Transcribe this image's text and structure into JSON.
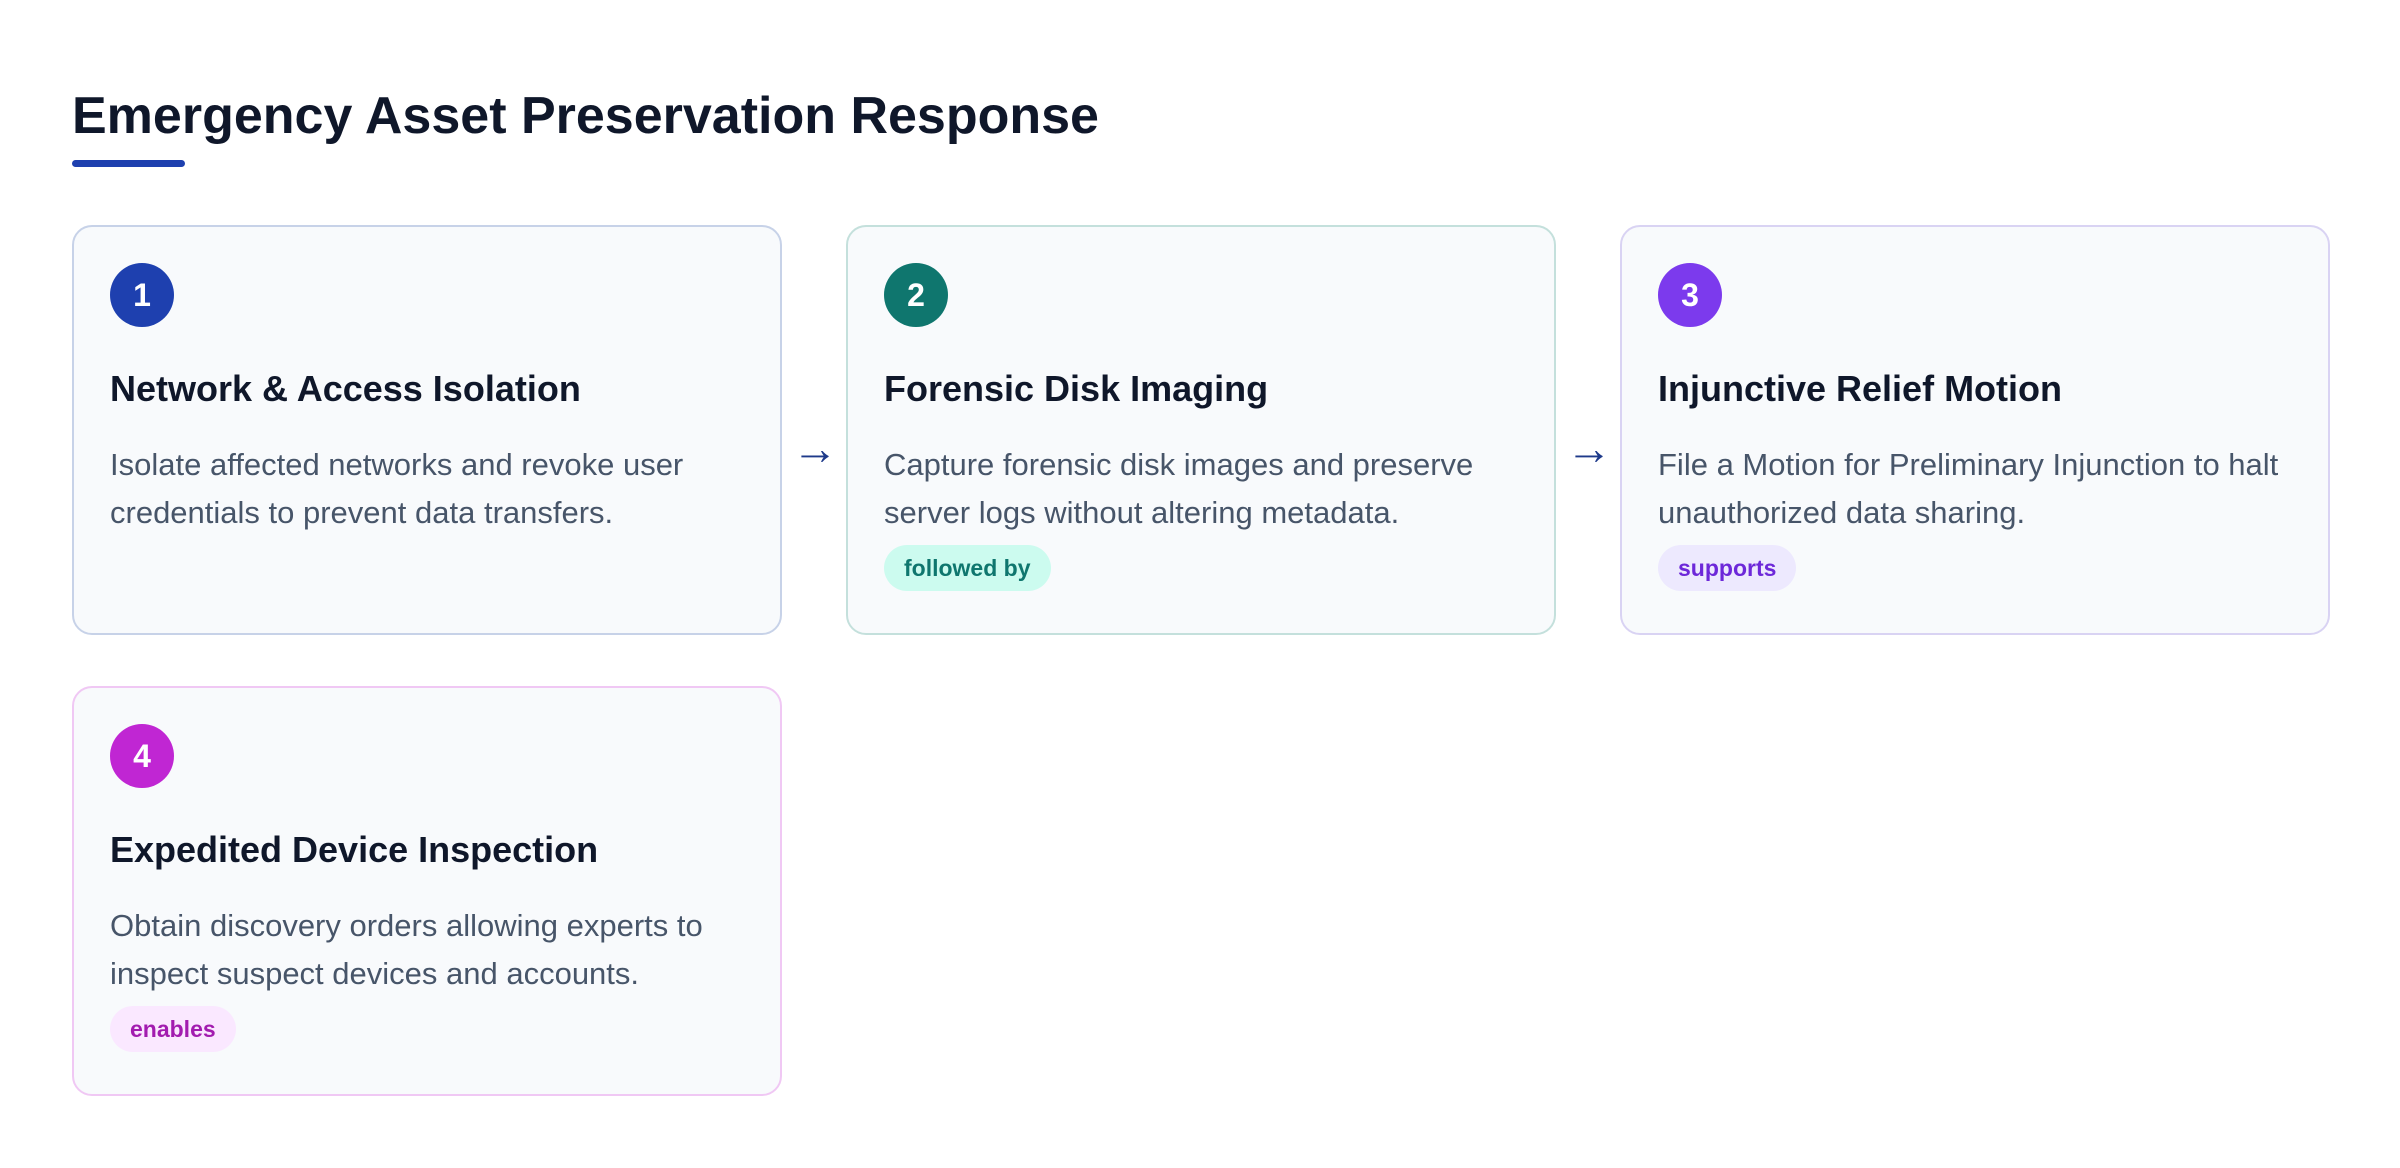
{
  "title": "Emergency Asset Preservation Response",
  "colors": {
    "accent": "#1e40af",
    "step1": "#1e40af",
    "step2": "#0f766e",
    "step3": "#7c3aed",
    "step4": "#c026d3"
  },
  "arrow_glyph": "→",
  "steps": [
    {
      "number": "1",
      "title": "Network & Access Isolation",
      "description": "Isolate affected networks and revoke user credentials to prevent data transfers."
    },
    {
      "number": "2",
      "title": "Forensic Disk Imaging",
      "description": "Capture forensic disk images and preserve server logs without altering metadata.",
      "relation": "followed by"
    },
    {
      "number": "3",
      "title": "Injunctive Relief Motion",
      "description": "File a Motion for Preliminary Injunction to halt unauthorized data sharing.",
      "relation": "supports"
    },
    {
      "number": "4",
      "title": "Expedited Device Inspection",
      "description": "Obtain discovery orders allowing experts to inspect suspect devices and accounts.",
      "relation": "enables"
    }
  ]
}
